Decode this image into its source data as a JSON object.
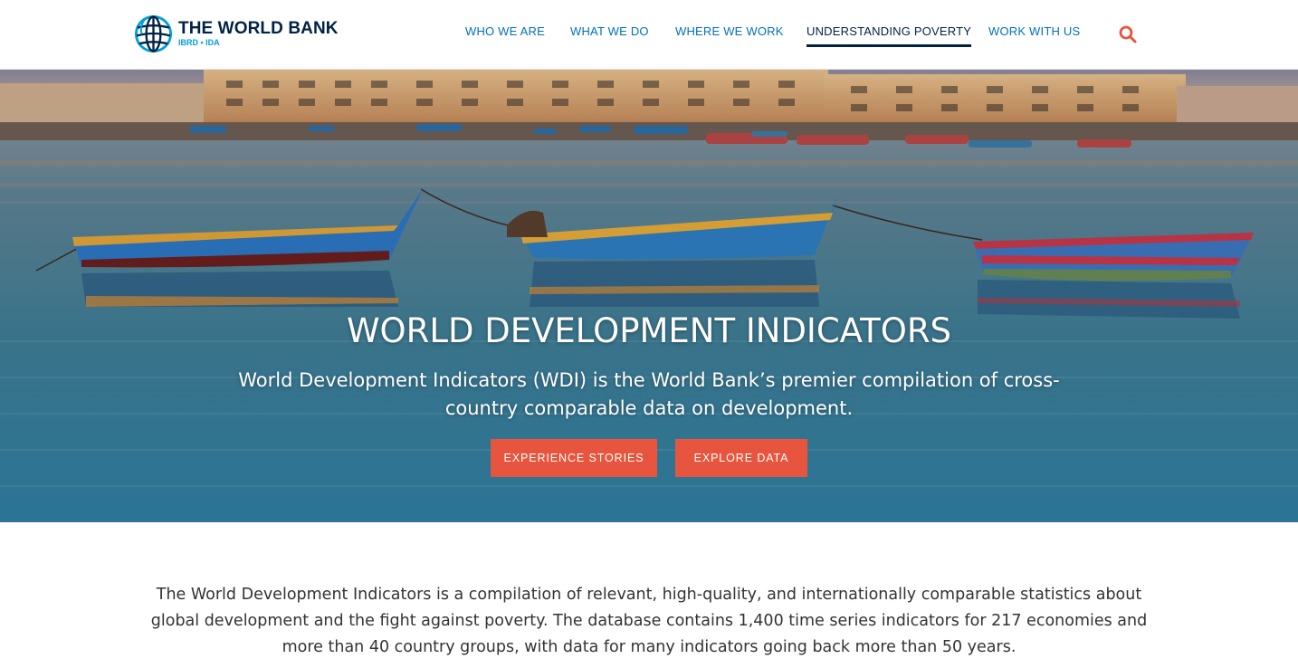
{
  "brand": {
    "name": "THE WORLD BANK",
    "subtitle": "IBRD • IDA",
    "logo_icon": "globe-icon",
    "colors": {
      "navy": "#002244",
      "blue": "#0071bc",
      "cyan": "#009fda"
    }
  },
  "nav": {
    "items": [
      {
        "label": "WHO WE ARE",
        "active": false
      },
      {
        "label": "WHAT WE DO",
        "active": false
      },
      {
        "label": "WHERE WE WORK",
        "active": false
      },
      {
        "label": "UNDERSTANDING POVERTY",
        "active": true
      },
      {
        "label": "WORK WITH US",
        "active": false
      }
    ],
    "search_icon": "search-icon",
    "search_color": "#e8553e"
  },
  "hero": {
    "title": "WORLD DEVELOPMENT INDICATORS",
    "subtitle": "World Development Indicators (WDI) is the World Bank’s premier compilation of cross-country comparable data on development.",
    "buttons": {
      "stories": "EXPERIENCE STORIES",
      "explore": "EXPLORE DATA"
    },
    "button_color": "#e8553e"
  },
  "intro": {
    "text": "The World Development Indicators is a compilation of relevant, high-quality, and internationally comparable statistics about global development and the fight against poverty. The database contains 1,400 time series indicators for 217 economies and more than 40 country groups, with data for many indicators going back more than 50 years."
  }
}
